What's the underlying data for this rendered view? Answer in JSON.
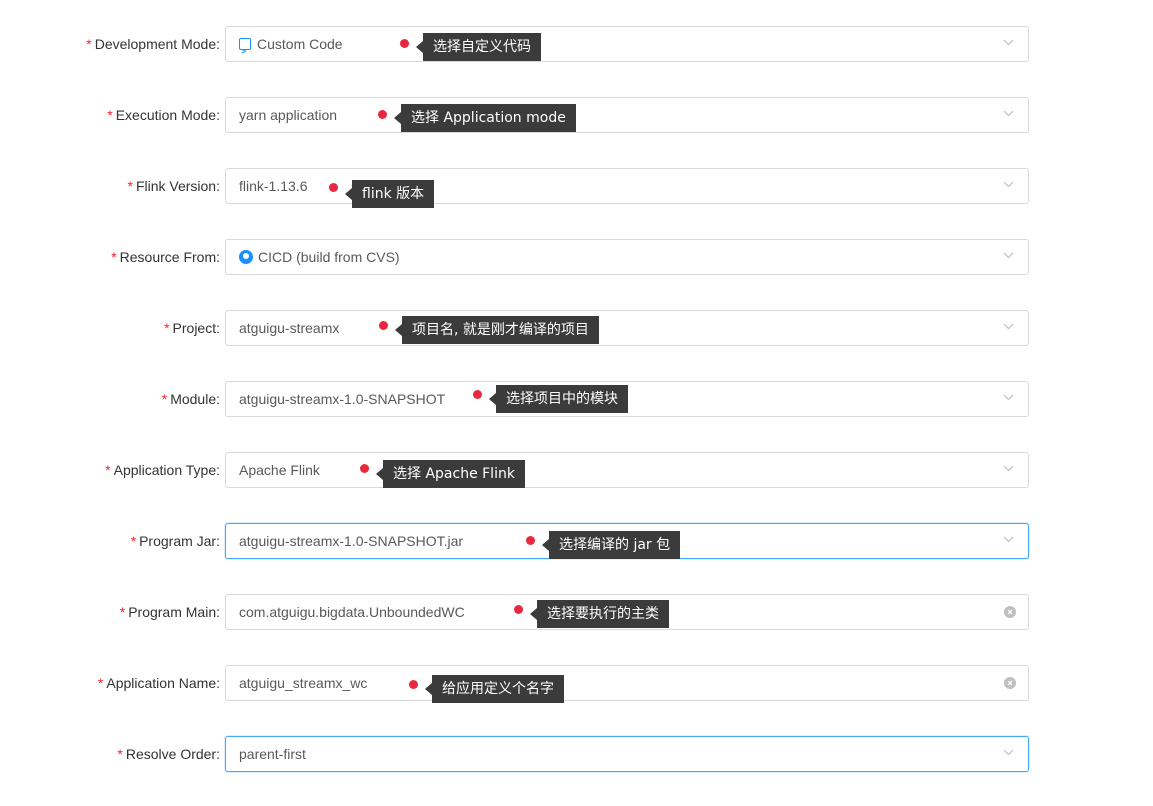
{
  "form": {
    "required_mark": "*",
    "rows": [
      {
        "label": "Development Mode:",
        "value": "Custom Code",
        "icon": "code-icon",
        "tip": "选择自定义代码"
      },
      {
        "label": "Execution Mode:",
        "value": "yarn application",
        "tip": "选择 Application mode"
      },
      {
        "label": "Flink Version:",
        "value": "flink-1.13.6",
        "tip": "flink 版本"
      },
      {
        "label": "Resource From:",
        "value": "CICD (build from CVS)",
        "icon": "github-icon",
        "tip": ""
      },
      {
        "label": "Project:",
        "value": "atguigu-streamx",
        "tip": "项目名, 就是刚才编译的项目"
      },
      {
        "label": "Module:",
        "value": "atguigu-streamx-1.0-SNAPSHOT",
        "tip": "选择项目中的模块"
      },
      {
        "label": "Application Type:",
        "value": "Apache Flink",
        "tip": "选择 Apache Flink"
      },
      {
        "label": "Program Jar:",
        "value": "atguigu-streamx-1.0-SNAPSHOT.jar",
        "tip": "选择编译的 jar 包"
      },
      {
        "label": "Program Main:",
        "value": "com.atguigu.bigdata.UnboundedWC",
        "tip": "选择要执行的主类"
      },
      {
        "label": "Application Name:",
        "value": "atguigu_streamx_wc",
        "tip": "给应用定义个名字"
      },
      {
        "label": "Resolve Order:",
        "value": "parent-first",
        "tip": ""
      }
    ]
  },
  "colors": {
    "required": "#f5222d",
    "annotation_dot": "#e8283c",
    "tooltip_bg": "#3b3b3b",
    "focus_border": "#40a9ff"
  }
}
